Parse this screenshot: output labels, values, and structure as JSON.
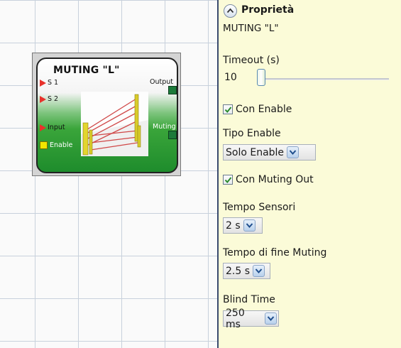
{
  "block": {
    "title": "MUTING \"L\"",
    "inputs": [
      "S 1",
      "S 2",
      "Input",
      "Enable"
    ],
    "outputs": [
      "Output",
      "Muting"
    ]
  },
  "panel": {
    "title": "Proprietà",
    "subtitle": "MUTING \"L\"",
    "timeout_label": "Timeout (s)",
    "timeout_value": "10",
    "con_enable_label": "Con Enable",
    "con_enable_checked": true,
    "tipo_enable_label": "Tipo Enable",
    "tipo_enable_value": "Solo Enable",
    "con_muting_out_label": "Con Muting Out",
    "con_muting_out_checked": true,
    "tempo_sensori_label": "Tempo Sensori",
    "tempo_sensori_value": "2 s",
    "tempo_fine_label": "Tempo di fine Muting",
    "tempo_fine_value": "2.5 s",
    "blind_time_label": "Blind Time",
    "blind_time_value": "250 ms"
  },
  "colors": {
    "panel_bg": "#fbfbd8",
    "block_green": "#2e9e3a",
    "input_red": "#e8322c",
    "enable_yellow": "#f2e600",
    "check_green": "#2a8a2a"
  }
}
